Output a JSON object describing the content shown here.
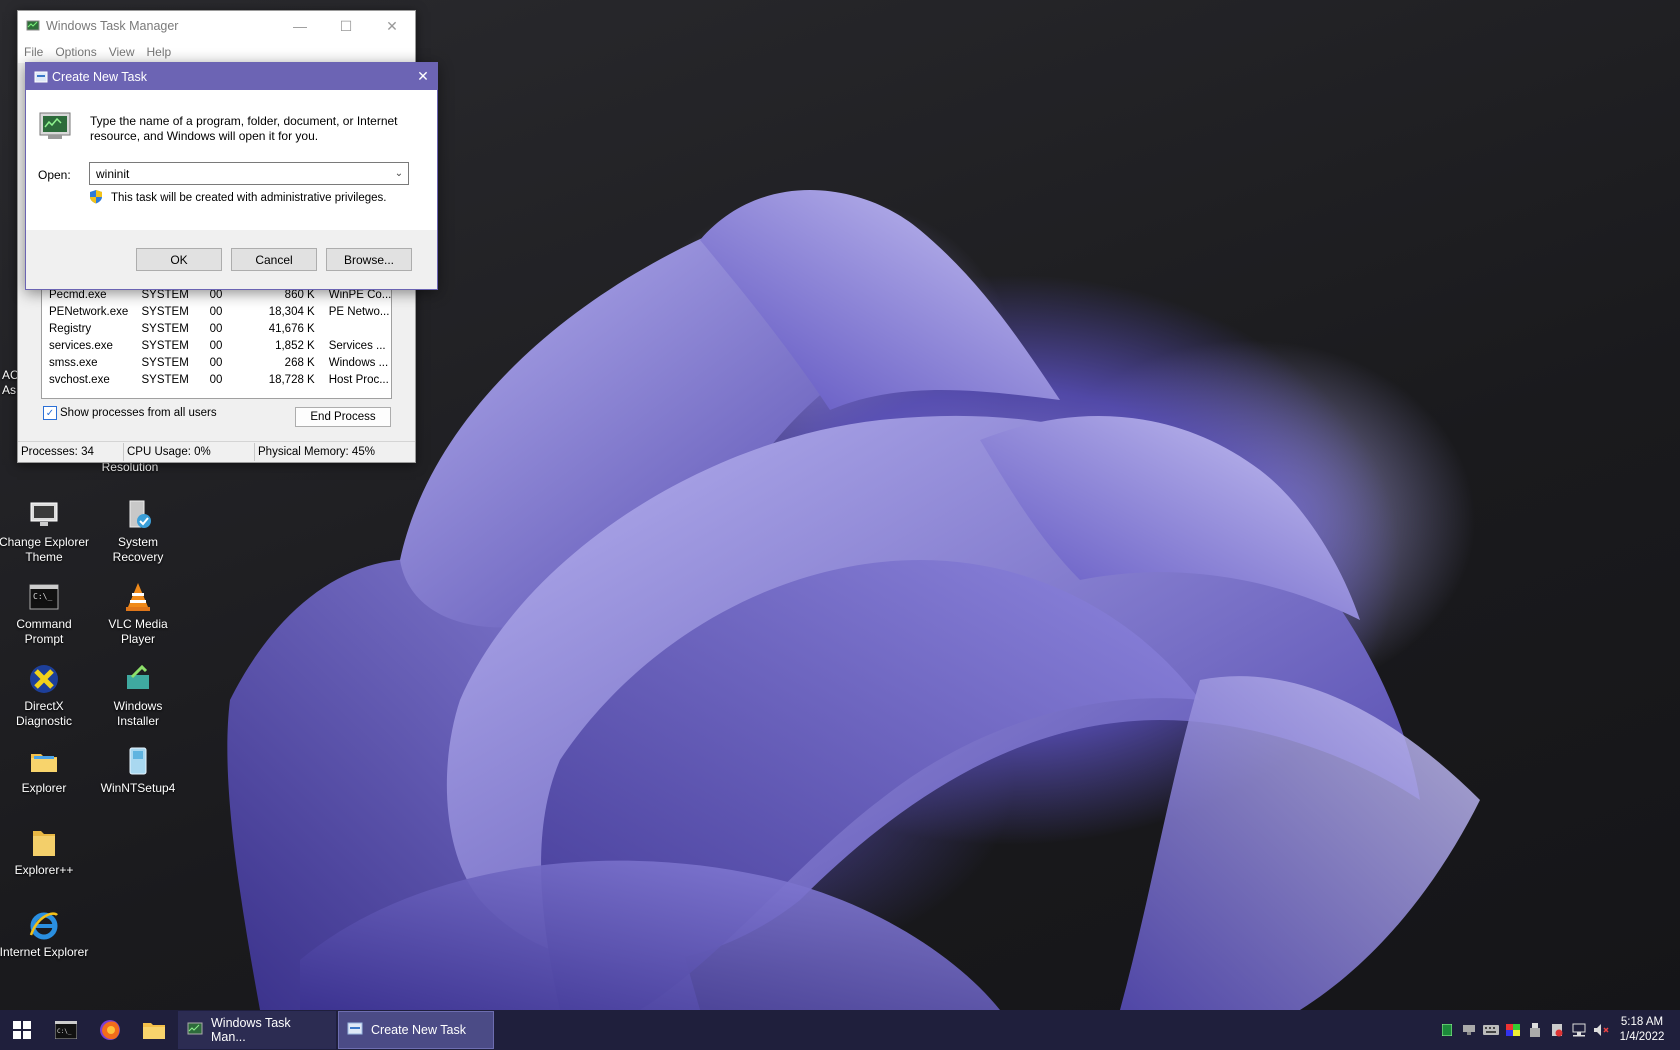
{
  "colors": {
    "taskbar": "#1f1f3c",
    "dialog_titlebar": "#6c64b4",
    "accent": "#2a6fd6"
  },
  "desktop_icons": [
    {
      "label": "Change Explorer Theme",
      "icon": "monitor-icon"
    },
    {
      "label": "System Recovery",
      "icon": "recovery-icon"
    },
    {
      "label": "Command Prompt",
      "icon": "cmd-icon"
    },
    {
      "label": "VLC Media Player",
      "icon": "vlc-cone-icon"
    },
    {
      "label": "DirectX Diagnostic",
      "icon": "directx-icon"
    },
    {
      "label": "Windows Installer",
      "icon": "installer-icon"
    },
    {
      "label": "Explorer",
      "icon": "folder-icon"
    },
    {
      "label": "WinNTSetup4",
      "icon": "winntsetup-icon"
    },
    {
      "label": "Explorer++",
      "icon": "folder-icon"
    },
    {
      "label": "Internet Explorer",
      "icon": "ie-icon"
    },
    {
      "label": "Resolution",
      "icon": "none"
    },
    {
      "label": "AC",
      "icon": "none"
    },
    {
      "label": "As",
      "icon": "none"
    }
  ],
  "task_manager": {
    "title": "Windows Task Manager",
    "menu": [
      "File",
      "Options",
      "View",
      "Help"
    ],
    "processes": [
      {
        "name": "Pecmd.exe",
        "user": "SYSTEM",
        "cpu": "00",
        "mem": "860 K",
        "desc": "WinPE Co..."
      },
      {
        "name": "PENetwork.exe",
        "user": "SYSTEM",
        "cpu": "00",
        "mem": "18,304 K",
        "desc": "PE Netwo..."
      },
      {
        "name": "Registry",
        "user": "SYSTEM",
        "cpu": "00",
        "mem": "41,676 K",
        "desc": ""
      },
      {
        "name": "services.exe",
        "user": "SYSTEM",
        "cpu": "00",
        "mem": "1,852 K",
        "desc": "Services ..."
      },
      {
        "name": "smss.exe",
        "user": "SYSTEM",
        "cpu": "00",
        "mem": "268 K",
        "desc": "Windows ..."
      },
      {
        "name": "svchost.exe",
        "user": "SYSTEM",
        "cpu": "00",
        "mem": "18,728 K",
        "desc": "Host Proc..."
      }
    ],
    "show_all_label": "Show processes from all users",
    "end_process_label": "End Process",
    "status": {
      "processes": "Processes: 34",
      "cpu": "CPU Usage: 0%",
      "memory": "Physical Memory: 45%"
    }
  },
  "dialog": {
    "title": "Create New Task",
    "prompt": "Type the name of a program, folder, document, or Internet resource, and Windows will open it for you.",
    "open_label": "Open:",
    "open_value": "wininit",
    "admin_note": "This task will be created with administrative privileges.",
    "ok_label": "OK",
    "cancel_label": "Cancel",
    "browse_label": "Browse..."
  },
  "taskbar": {
    "tasks": [
      {
        "label": "Windows Task Man...",
        "active": false
      },
      {
        "label": "Create New Task",
        "active": true
      }
    ],
    "clock_time": "5:18 AM",
    "clock_date": "1/4/2022"
  }
}
